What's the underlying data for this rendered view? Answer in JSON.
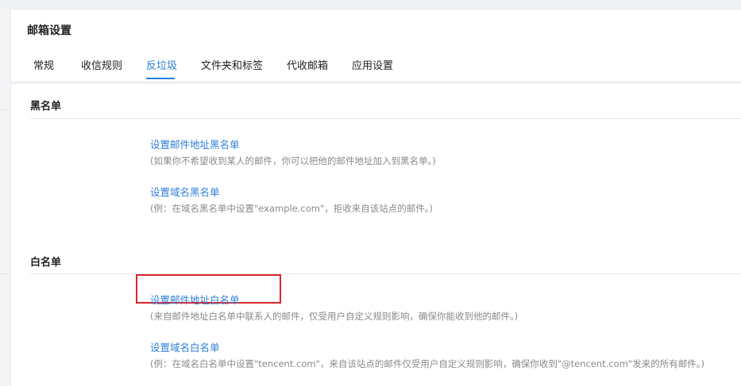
{
  "header": {
    "title": "邮箱设置",
    "tabs": [
      {
        "label": "常规"
      },
      {
        "label": "收信规则"
      },
      {
        "label": "反垃圾",
        "active": true
      },
      {
        "label": "文件夹和标签"
      },
      {
        "label": "代收邮箱"
      },
      {
        "label": "应用设置"
      }
    ]
  },
  "blacklist": {
    "title": "黑名单",
    "address_link": "设置邮件地址黑名单",
    "address_desc": "(如果你不希望收到某人的邮件，你可以把他的邮件地址加入到黑名单。)",
    "domain_link": "设置域名黑名单",
    "domain_desc": "(例：在域名黑名单中设置\"example.com\"，拒收来自该站点的邮件。)"
  },
  "whitelist": {
    "title": "白名单",
    "address_link": "设置邮件地址白名单",
    "address_desc": "(来自邮件地址白名单中联系人的邮件，仅受用户自定义规则影响，确保你能收到他的邮件。)",
    "domain_link": "设置域名白名单",
    "domain_desc": "(例：在域名白名单中设置\"tencent.com\"，来自该站点的邮件仅受用户自定义规则影响，确保你收到\"@tencent.com\"发来的所有邮件。)"
  },
  "colors": {
    "link": "#2d7fd8",
    "highlight": "#d9262c"
  }
}
